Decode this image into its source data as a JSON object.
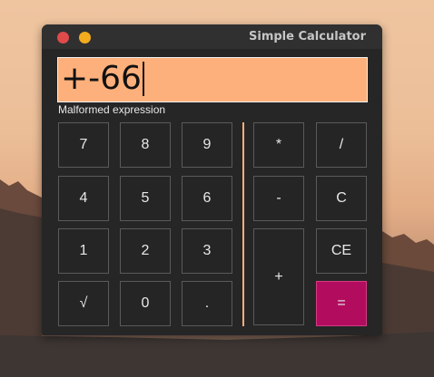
{
  "window": {
    "title": "Simple Calculator"
  },
  "display": {
    "value": "+-66"
  },
  "status": {
    "message": "Malformed expression"
  },
  "keypad": {
    "k7": "7",
    "k8": "8",
    "k9": "9",
    "k4": "4",
    "k5": "5",
    "k6": "6",
    "k1": "1",
    "k2": "2",
    "k3": "3",
    "sqrt": "√",
    "k0": "0",
    "dot": "."
  },
  "operators": {
    "multiply": "*",
    "divide": "/",
    "minus": "-",
    "clear": "C",
    "clear_entry": "CE",
    "plus": "+",
    "equals": "="
  },
  "colors": {
    "display_bg": "#fdb07b",
    "equals_bg": "#b20c5f",
    "window_bg": "#262626",
    "close_dot": "#e04a4a",
    "minimize_dot": "#f2ac1e"
  }
}
